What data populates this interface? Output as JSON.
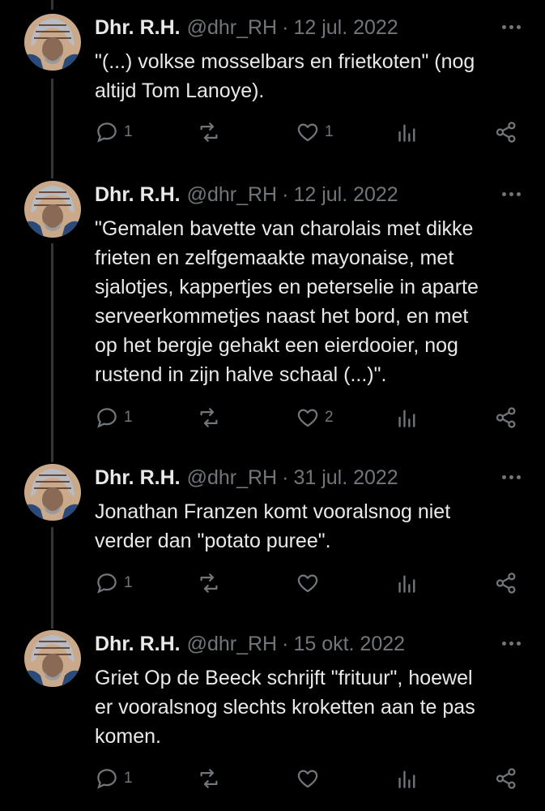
{
  "tweets": [
    {
      "name": "Dhr. R.H.",
      "handle": "@dhr_RH",
      "separator": "·",
      "date": "12 jul. 2022",
      "lines": [
        "\"(...) volkse mosselbars en frietkoten\" (nog",
        "altijd Tom Lanoye)."
      ],
      "replies": "1",
      "likes": "1"
    },
    {
      "name": "Dhr. R.H.",
      "handle": "@dhr_RH",
      "separator": "·",
      "date": "12 jul. 2022",
      "lines": [
        "\"Gemalen bavette van charolais met dikke",
        "frieten en zelfgemaakte mayonaise, met",
        "sjalotjes, kappertjes en peterselie in aparte",
        "serveerkommetjes naast het bord, en met",
        "op het bergje gehakt een eierdooier, nog",
        "rustend in zijn halve schaal (...)\"."
      ],
      "replies": "1",
      "likes": "2"
    },
    {
      "name": "Dhr. R.H.",
      "handle": "@dhr_RH",
      "separator": "·",
      "date": "31 jul. 2022",
      "lines": [
        "Jonathan Franzen komt vooralsnog niet",
        "verder dan \"potato puree\"."
      ],
      "replies": "1",
      "likes": ""
    },
    {
      "name": "Dhr. R.H.",
      "handle": "@dhr_RH",
      "separator": "·",
      "date": "15 okt. 2022",
      "lines": [
        "Griet Op de Beeck schrijft \"frituur\", hoewel",
        "er vooralsnog slechts kroketten aan te pas",
        "komen."
      ],
      "replies": "1",
      "likes": ""
    }
  ],
  "icons": {
    "reply": "speech-bubble",
    "retweet": "retweet-arrows",
    "like": "heart-outline",
    "views": "bar-chart",
    "share": "share-nodes",
    "more": "three-dots"
  },
  "colors": {
    "background": "#000000",
    "text": "#e7e9ea",
    "muted": "#71767b",
    "thread_line": "#333639"
  }
}
